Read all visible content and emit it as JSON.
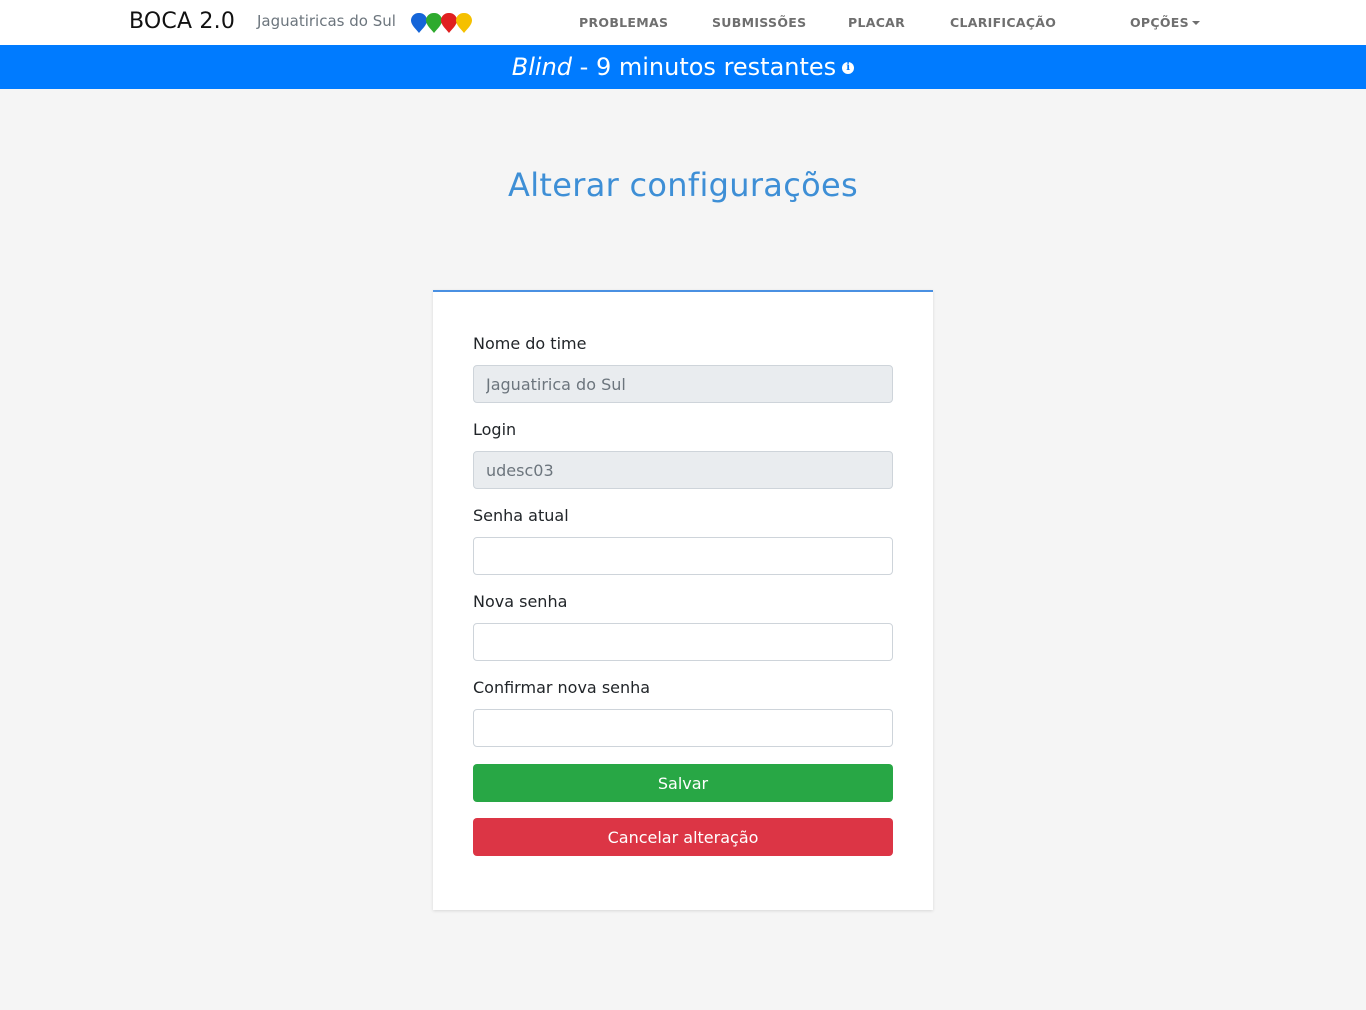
{
  "navbar": {
    "brand": "BOCA 2.0",
    "team": "Jaguatiricas do Sul",
    "balloon_colors": [
      "#1565d8",
      "#2eaa2e",
      "#e02020",
      "#f5c000"
    ],
    "links": {
      "problemas": "PROBLEMAS",
      "submissoes": "SUBMISSÕES",
      "placar": "PLACAR",
      "clarificacao": "CLARIFICAÇÃO",
      "opcoes": "OPÇÕES"
    }
  },
  "banner": {
    "mode": "Blind",
    "separator": " - ",
    "remaining": "9 minutos restantes",
    "icon": "info-icon"
  },
  "page": {
    "title": "Alterar configurações"
  },
  "form": {
    "team_name": {
      "label": "Nome do time",
      "value": "Jaguatirica do Sul"
    },
    "login": {
      "label": "Login",
      "value": "udesc03"
    },
    "current_password": {
      "label": "Senha atual",
      "value": ""
    },
    "new_password": {
      "label": "Nova senha",
      "value": ""
    },
    "confirm_password": {
      "label": "Confirmar nova senha",
      "value": ""
    },
    "save_label": "Salvar",
    "cancel_label": "Cancelar alteração"
  },
  "colors": {
    "primary": "#007bff",
    "title": "#3e8fd6",
    "success": "#28a745",
    "danger": "#dc3545"
  }
}
